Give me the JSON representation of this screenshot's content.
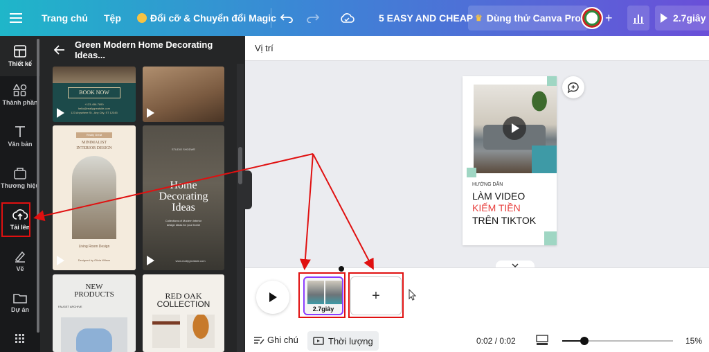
{
  "topbar": {
    "home": "Trang chủ",
    "file": "Tệp",
    "magic": "Đổi cỡ & Chuyển đổi Magic",
    "doc_title": "5 EASY AND CHEAP",
    "pro": "Dùng thử Canva Pro",
    "duration": "2.7giây"
  },
  "rail": {
    "design": "Thiết kế",
    "elements": "Thành phần",
    "text": "Văn bản",
    "brand": "Thương hiệu",
    "uploads": "Tải lên",
    "draw": "Vẽ",
    "projects": "Dự án"
  },
  "panel": {
    "title": "Green Modern Home Decorating Ideas...",
    "t1": {
      "button": "BOOK NOW",
      "line1": "+123-456-7890",
      "line2": "hello@reallygreatsite.com",
      "line3": "123 Anywhere St., Any City, ST 12345"
    },
    "t3": {
      "tag": "Really Great",
      "title1": "MINIMALIST",
      "title2": "INTERIOR DESIGN",
      "caption": "Living Room Design",
      "credit": "Designed by Olivia Wilson"
    },
    "t4": {
      "brand": "STUDIO SHODWE",
      "title1": "Home",
      "title2": "Decorating",
      "title3": "Ideas",
      "sub1": "Collections of Modern Interior",
      "sub2": "design ideas for your home",
      "site": "www.reallygreatsite.com"
    },
    "t5": {
      "title1": "NEW",
      "title2": "PRODUCTS",
      "brand": "FAUGET ARCHIVE"
    },
    "t6": {
      "title1": "RED OAK",
      "title2": "COLLECTION"
    }
  },
  "editor": {
    "position": "Vị trí"
  },
  "canvas": {
    "kicker": "HƯỚNG DẪN",
    "line1": "LÀM VIDEO",
    "line2": "KIẾM TIỀN",
    "line3": "TRÊN TIKTOK"
  },
  "timeline": {
    "clip_duration": "2.7giây",
    "notes": "Ghi chú",
    "duration_btn": "Thời lượng",
    "time": "0:02 / 0:02",
    "zoom": "15%",
    "zoom_level": 0.2
  },
  "colors": {
    "accent_red": "#e01010",
    "kiem_tien": "#e8413f",
    "teal": "#1e6e6a",
    "mint": "#9fd6c3"
  }
}
